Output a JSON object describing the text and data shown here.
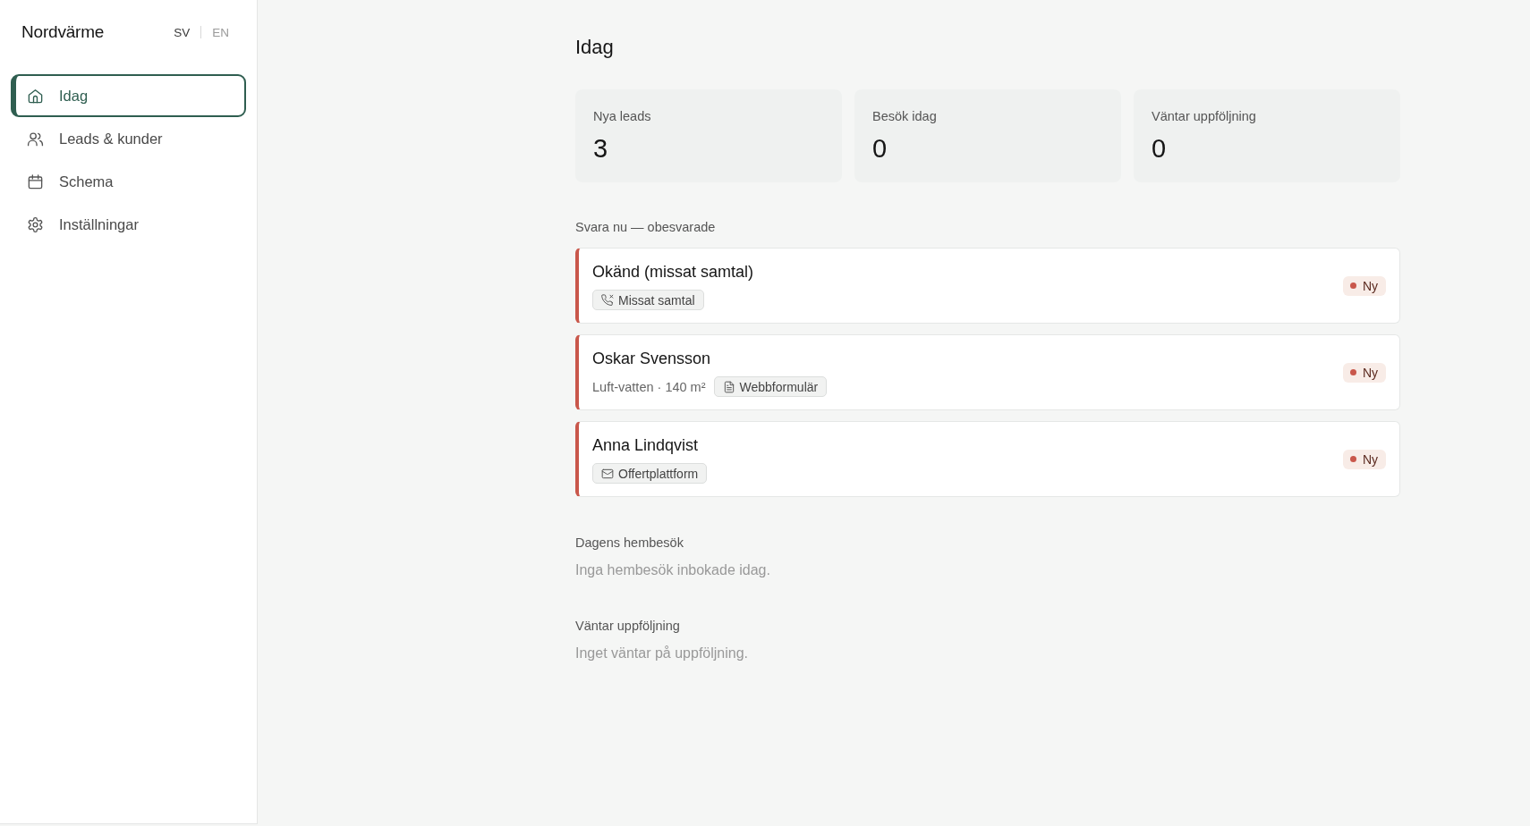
{
  "sidebar": {
    "brand": "Nordvärme",
    "languages": [
      {
        "label": "SV",
        "selected": true
      },
      {
        "label": "EN",
        "selected": false
      }
    ],
    "nav": [
      {
        "label": "Idag",
        "selected": true
      },
      {
        "label": "Leads & kunder",
        "selected": false
      },
      {
        "label": "Schema",
        "selected": false
      },
      {
        "label": "Inställningar",
        "selected": false
      }
    ]
  },
  "main": {
    "title": "Idag",
    "stats": [
      {
        "label": "Nya leads",
        "value": "3"
      },
      {
        "label": "Besök idag",
        "value": "0"
      },
      {
        "label": "Väntar uppföljning",
        "value": "0"
      }
    ],
    "unanswered": {
      "heading": "Svara nu — obesvarade",
      "leads": [
        {
          "name": "Okänd (missat samtal)",
          "tag": {
            "kind": "call",
            "label": "Missat samtal"
          },
          "status": "Ny"
        },
        {
          "name": "Oskar Svensson",
          "details": "Luft-vatten · 140 m²",
          "tag": {
            "kind": "form",
            "label": "Webbformulär"
          },
          "status": "Ny"
        },
        {
          "name": "Anna Lindqvist",
          "tag": {
            "kind": "mail",
            "label": "Offertplattform"
          },
          "status": "Ny"
        }
      ]
    },
    "sections": [
      {
        "heading": "Dagens hembesök",
        "empty_text": "Inga hembesök inbokade idag."
      },
      {
        "heading": "Väntar uppföljning",
        "empty_text": "Inget väntar på uppföljning."
      }
    ]
  }
}
